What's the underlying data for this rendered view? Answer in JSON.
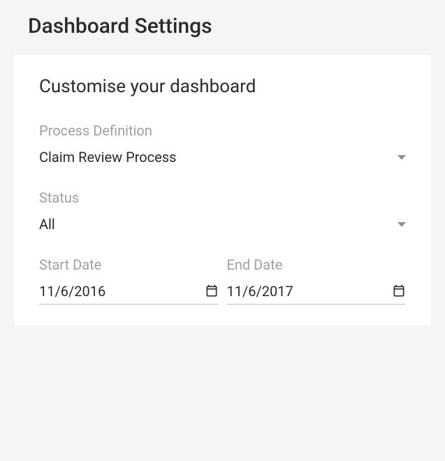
{
  "pageTitle": "Dashboard Settings",
  "card": {
    "title": "Customise your dashboard",
    "processDefinition": {
      "label": "Process Definition",
      "value": "Claim Review Process"
    },
    "status": {
      "label": "Status",
      "value": "All"
    },
    "startDate": {
      "label": "Start Date",
      "value": "11/6/2016"
    },
    "endDate": {
      "label": "End Date",
      "value": "11/6/2017"
    }
  }
}
